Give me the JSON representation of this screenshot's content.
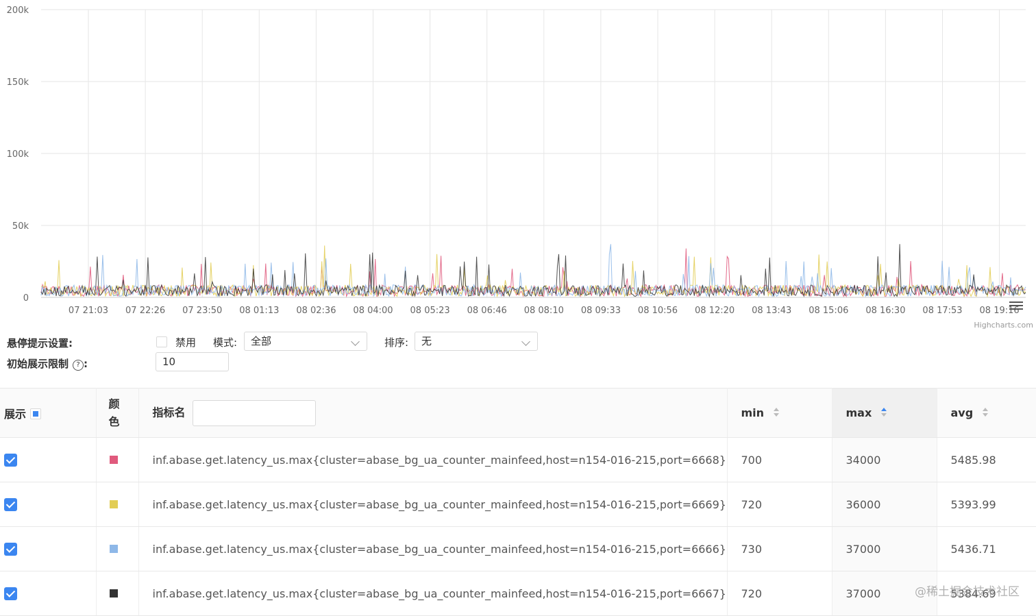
{
  "chart_data": {
    "type": "line",
    "y_ticks": [
      "200k",
      "150k",
      "100k",
      "50k",
      "0"
    ],
    "y_values": [
      200000,
      150000,
      100000,
      50000,
      0
    ],
    "ylim": [
      0,
      200000
    ],
    "x_ticks": [
      "07 21:03",
      "07 22:26",
      "07 23:50",
      "08 01:13",
      "08 02:36",
      "08 04:00",
      "08 05:23",
      "08 06:46",
      "08 08:10",
      "08 09:33",
      "08 10:56",
      "08 12:20",
      "08 13:43",
      "08 15:06",
      "08 16:30",
      "08 17:53",
      "08 19:16"
    ],
    "credit": "Highcharts.com",
    "grid": true,
    "series": [
      {
        "color": "#e05a7d",
        "min": 700,
        "max": 34000,
        "avg": 5485.98
      },
      {
        "color": "#e2cd55",
        "min": 720,
        "max": 36000,
        "avg": 5393.99
      },
      {
        "color": "#8eb8e8",
        "min": 730,
        "max": 37000,
        "avg": 5436.71
      },
      {
        "color": "#333333",
        "min": 720,
        "max": 37000,
        "avg": 5384.69
      }
    ]
  },
  "settings": {
    "hover_label": "悬停提示设置:",
    "disable_label": "禁用",
    "mode_label": "模式:",
    "mode_value": "全部",
    "sort_label": "排序:",
    "sort_value": "无",
    "limit_label": "初始展示限制",
    "limit_help": "?",
    "limit_value": "10"
  },
  "table": {
    "headers": {
      "show": "展示",
      "color": "颜色",
      "name": "指标名",
      "min": "min",
      "max": "max",
      "avg": "avg"
    },
    "rows": [
      {
        "color": "#e05a7d",
        "name": "inf.abase.get.latency_us.max{cluster=abase_bg_ua_counter_mainfeed,host=n154-016-215,port=6668}",
        "min": "700",
        "max": "34000",
        "avg": "5485.98"
      },
      {
        "color": "#e2cd55",
        "name": "inf.abase.get.latency_us.max{cluster=abase_bg_ua_counter_mainfeed,host=n154-016-215,port=6669}",
        "min": "720",
        "max": "36000",
        "avg": "5393.99"
      },
      {
        "color": "#8eb8e8",
        "name": "inf.abase.get.latency_us.max{cluster=abase_bg_ua_counter_mainfeed,host=n154-016-215,port=6666}",
        "min": "730",
        "max": "37000",
        "avg": "5436.71"
      },
      {
        "color": "#333333",
        "name": "inf.abase.get.latency_us.max{cluster=abase_bg_ua_counter_mainfeed,host=n154-016-215,port=6667}",
        "min": "720",
        "max": "37000",
        "avg": "5384.69"
      }
    ]
  },
  "watermark": "@稀土掘金技术社区"
}
